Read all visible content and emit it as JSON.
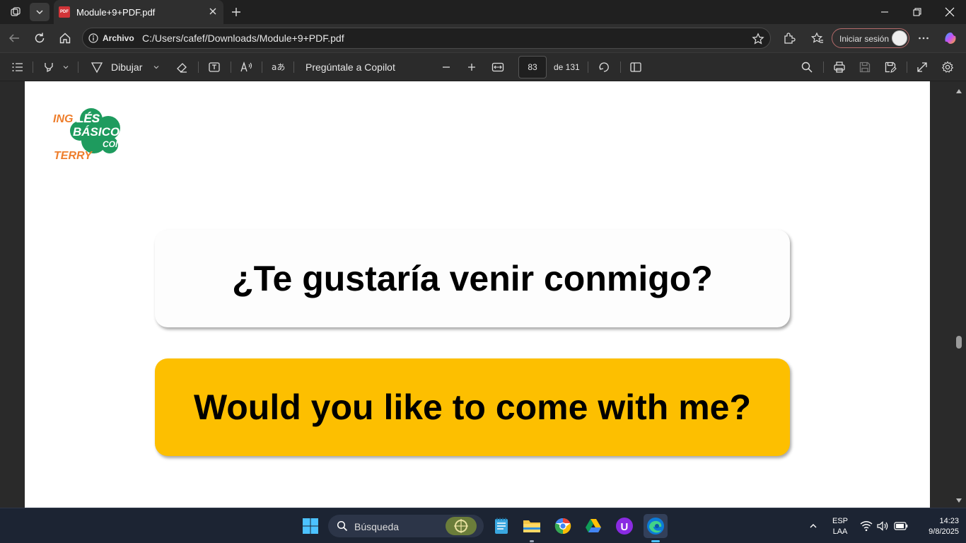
{
  "browser": {
    "tab_title": "Module+9+PDF.pdf",
    "tab_badge": "PDF",
    "address_site_label": "Archivo",
    "address_url": "C:/Users/cafef/Downloads/Module+9+PDF.pdf",
    "signin_label": "Iniciar sesión"
  },
  "pdf_toolbar": {
    "draw_label": "Dibujar",
    "copilot_label": "Pregúntale a Copilot",
    "current_page": "83",
    "page_total_label": "de 131"
  },
  "document": {
    "logo_text": "INGLÉS BÁSICO CON TERRY",
    "spanish_phrase": "¿Te gustaría venir conmigo?",
    "english_phrase": "Would you like to come with me?"
  },
  "taskbar": {
    "search_label": "Búsqueda",
    "lang_top": "ESP",
    "lang_bottom": "LAA",
    "time": "14:23",
    "date": "9/8/2025"
  },
  "colors": {
    "accent_yellow": "#fdbf00",
    "logo_green": "#1e9b5e",
    "logo_orange": "#ee7e2c"
  }
}
